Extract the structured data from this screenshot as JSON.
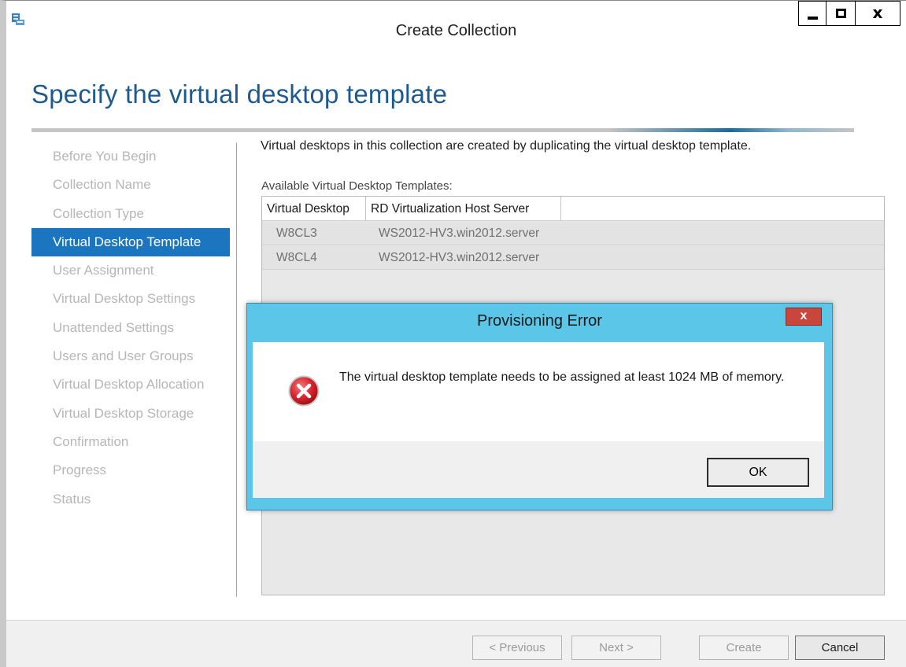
{
  "window": {
    "title": "Create Collection",
    "close_glyph": "x"
  },
  "page": {
    "heading": "Specify the virtual desktop template"
  },
  "nav": {
    "items": [
      {
        "label": "Before You Begin"
      },
      {
        "label": "Collection Name"
      },
      {
        "label": "Collection Type"
      },
      {
        "label": "Virtual Desktop Template"
      },
      {
        "label": "User Assignment"
      },
      {
        "label": "Virtual Desktop Settings"
      },
      {
        "label": "Unattended Settings"
      },
      {
        "label": "Users and User Groups"
      },
      {
        "label": "Virtual Desktop Allocation"
      },
      {
        "label": "Virtual Desktop Storage"
      },
      {
        "label": "Confirmation"
      },
      {
        "label": "Progress"
      },
      {
        "label": "Status"
      }
    ],
    "active_index": 3
  },
  "content": {
    "description": "Virtual desktops in this collection are created by duplicating the virtual desktop template.",
    "available_label": "Available Virtual Desktop Templates:",
    "table": {
      "columns": [
        "Virtual Desktop",
        "RD Virtualization Host Server"
      ],
      "rows": [
        [
          "W8CL3",
          "WS2012-HV3.win2012.server"
        ],
        [
          "W8CL4",
          "WS2012-HV3.win2012.server"
        ]
      ]
    }
  },
  "footer": {
    "previous_label": "< Previous",
    "next_label": "Next >",
    "create_label": "Create",
    "cancel_label": "Cancel"
  },
  "dialog": {
    "title": "Provisioning Error",
    "close_glyph": "x",
    "message": "The virtual desktop template needs to be assigned at least 1024 MB of memory.",
    "ok_label": "OK",
    "icon": "error-icon"
  },
  "colors": {
    "accent": "#1c76bf",
    "heading": "#1f5a8e",
    "dialog_frame": "#5cc6e8",
    "dialog_close": "#c9463d",
    "error_red": "#d9232d"
  }
}
